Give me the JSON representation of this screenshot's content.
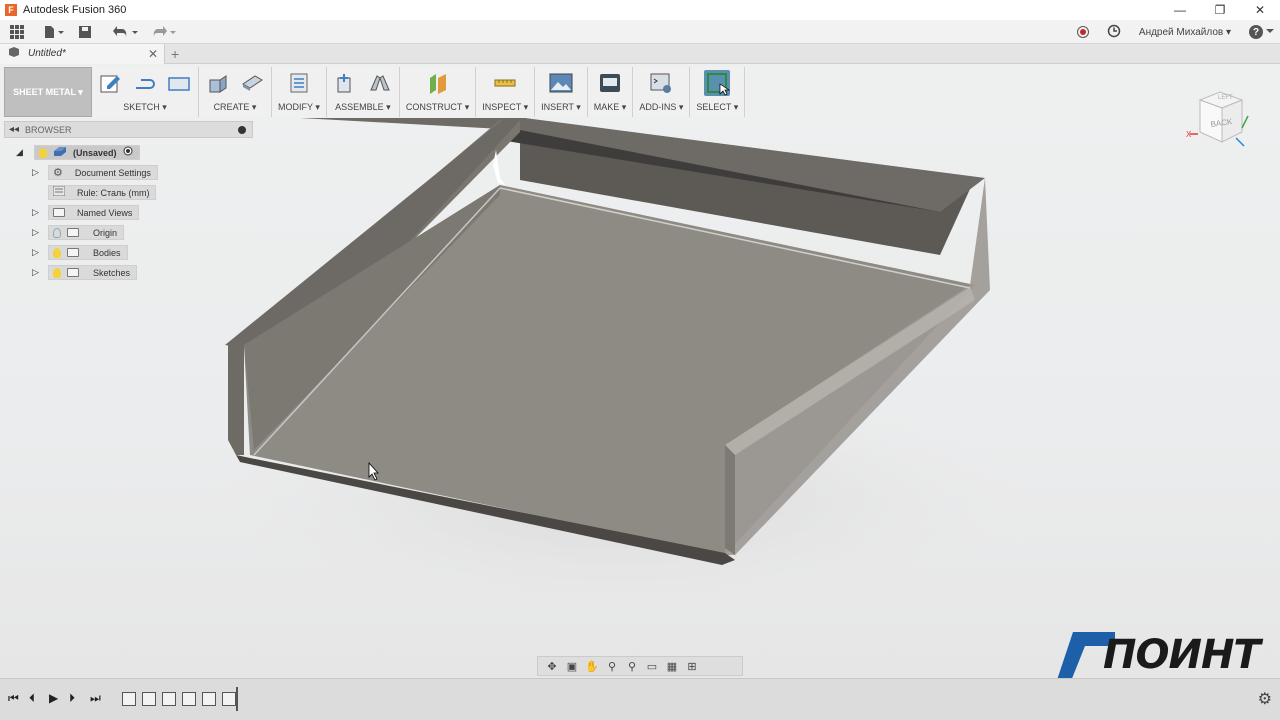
{
  "window": {
    "title": "Autodesk Fusion 360",
    "app_icon": "F",
    "controls": [
      "—",
      "❐",
      "✕"
    ]
  },
  "qat": {
    "user_name": "Андрей Михайлов ▾",
    "help": "?"
  },
  "tabs": [
    {
      "label": "Untitled*"
    }
  ],
  "toolbar": {
    "workspace": "SHEET METAL ▾",
    "groups": [
      {
        "label": "SKETCH ▾"
      },
      {
        "label": "CREATE ▾"
      },
      {
        "label": "MODIFY ▾"
      },
      {
        "label": "ASSEMBLE ▾"
      },
      {
        "label": "CONSTRUCT ▾"
      },
      {
        "label": "INSPECT ▾"
      },
      {
        "label": "INSERT ▾"
      },
      {
        "label": "MAKE ▾"
      },
      {
        "label": "ADD-INS ▾"
      },
      {
        "label": "SELECT ▾"
      }
    ]
  },
  "browser": {
    "title": "BROWSER",
    "root": "(Unsaved)",
    "items": [
      {
        "label": "Document Settings"
      },
      {
        "label": "Rule: Сталь (mm)"
      },
      {
        "label": "Named Views"
      },
      {
        "label": "Origin"
      },
      {
        "label": "Bodies"
      },
      {
        "label": "Sketches"
      }
    ]
  },
  "viewcube": {
    "face": "BACK",
    "axis_x": "X",
    "axis_top": "LEFT"
  },
  "watermark": {
    "text": "ПОИНТ"
  },
  "colors": {
    "accent": "#5a8fb0",
    "logo_blue": "#1d5fa8",
    "part": "#8e8a84"
  }
}
